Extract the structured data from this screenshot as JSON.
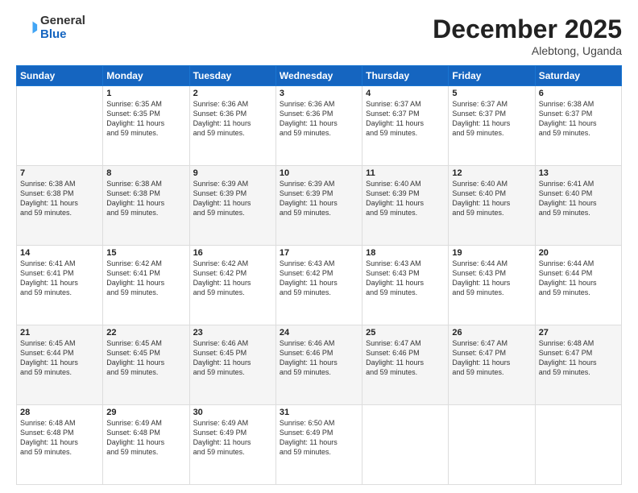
{
  "header": {
    "logo_general": "General",
    "logo_blue": "Blue",
    "month_title": "December 2025",
    "location": "Alebtong, Uganda"
  },
  "weekdays": [
    "Sunday",
    "Monday",
    "Tuesday",
    "Wednesday",
    "Thursday",
    "Friday",
    "Saturday"
  ],
  "days": {
    "d1": {
      "num": "1",
      "rise": "6:35 AM",
      "set": "6:35 PM",
      "daylight": "11 hours and 59 minutes."
    },
    "d2": {
      "num": "2",
      "rise": "6:36 AM",
      "set": "6:36 PM",
      "daylight": "11 hours and 59 minutes."
    },
    "d3": {
      "num": "3",
      "rise": "6:36 AM",
      "set": "6:36 PM",
      "daylight": "11 hours and 59 minutes."
    },
    "d4": {
      "num": "4",
      "rise": "6:37 AM",
      "set": "6:37 PM",
      "daylight": "11 hours and 59 minutes."
    },
    "d5": {
      "num": "5",
      "rise": "6:37 AM",
      "set": "6:37 PM",
      "daylight": "11 hours and 59 minutes."
    },
    "d6": {
      "num": "6",
      "rise": "6:38 AM",
      "set": "6:37 PM",
      "daylight": "11 hours and 59 minutes."
    },
    "d7": {
      "num": "7",
      "rise": "6:38 AM",
      "set": "6:38 PM",
      "daylight": "11 hours and 59 minutes."
    },
    "d8": {
      "num": "8",
      "rise": "6:38 AM",
      "set": "6:38 PM",
      "daylight": "11 hours and 59 minutes."
    },
    "d9": {
      "num": "9",
      "rise": "6:39 AM",
      "set": "6:39 PM",
      "daylight": "11 hours and 59 minutes."
    },
    "d10": {
      "num": "10",
      "rise": "6:39 AM",
      "set": "6:39 PM",
      "daylight": "11 hours and 59 minutes."
    },
    "d11": {
      "num": "11",
      "rise": "6:40 AM",
      "set": "6:39 PM",
      "daylight": "11 hours and 59 minutes."
    },
    "d12": {
      "num": "12",
      "rise": "6:40 AM",
      "set": "6:40 PM",
      "daylight": "11 hours and 59 minutes."
    },
    "d13": {
      "num": "13",
      "rise": "6:41 AM",
      "set": "6:40 PM",
      "daylight": "11 hours and 59 minutes."
    },
    "d14": {
      "num": "14",
      "rise": "6:41 AM",
      "set": "6:41 PM",
      "daylight": "11 hours and 59 minutes."
    },
    "d15": {
      "num": "15",
      "rise": "6:42 AM",
      "set": "6:41 PM",
      "daylight": "11 hours and 59 minutes."
    },
    "d16": {
      "num": "16",
      "rise": "6:42 AM",
      "set": "6:42 PM",
      "daylight": "11 hours and 59 minutes."
    },
    "d17": {
      "num": "17",
      "rise": "6:43 AM",
      "set": "6:42 PM",
      "daylight": "11 hours and 59 minutes."
    },
    "d18": {
      "num": "18",
      "rise": "6:43 AM",
      "set": "6:43 PM",
      "daylight": "11 hours and 59 minutes."
    },
    "d19": {
      "num": "19",
      "rise": "6:44 AM",
      "set": "6:43 PM",
      "daylight": "11 hours and 59 minutes."
    },
    "d20": {
      "num": "20",
      "rise": "6:44 AM",
      "set": "6:44 PM",
      "daylight": "11 hours and 59 minutes."
    },
    "d21": {
      "num": "21",
      "rise": "6:45 AM",
      "set": "6:44 PM",
      "daylight": "11 hours and 59 minutes."
    },
    "d22": {
      "num": "22",
      "rise": "6:45 AM",
      "set": "6:45 PM",
      "daylight": "11 hours and 59 minutes."
    },
    "d23": {
      "num": "23",
      "rise": "6:46 AM",
      "set": "6:45 PM",
      "daylight": "11 hours and 59 minutes."
    },
    "d24": {
      "num": "24",
      "rise": "6:46 AM",
      "set": "6:46 PM",
      "daylight": "11 hours and 59 minutes."
    },
    "d25": {
      "num": "25",
      "rise": "6:47 AM",
      "set": "6:46 PM",
      "daylight": "11 hours and 59 minutes."
    },
    "d26": {
      "num": "26",
      "rise": "6:47 AM",
      "set": "6:47 PM",
      "daylight": "11 hours and 59 minutes."
    },
    "d27": {
      "num": "27",
      "rise": "6:48 AM",
      "set": "6:47 PM",
      "daylight": "11 hours and 59 minutes."
    },
    "d28": {
      "num": "28",
      "rise": "6:48 AM",
      "set": "6:48 PM",
      "daylight": "11 hours and 59 minutes."
    },
    "d29": {
      "num": "29",
      "rise": "6:49 AM",
      "set": "6:48 PM",
      "daylight": "11 hours and 59 minutes."
    },
    "d30": {
      "num": "30",
      "rise": "6:49 AM",
      "set": "6:49 PM",
      "daylight": "11 hours and 59 minutes."
    },
    "d31": {
      "num": "31",
      "rise": "6:50 AM",
      "set": "6:49 PM",
      "daylight": "11 hours and 59 minutes."
    }
  }
}
